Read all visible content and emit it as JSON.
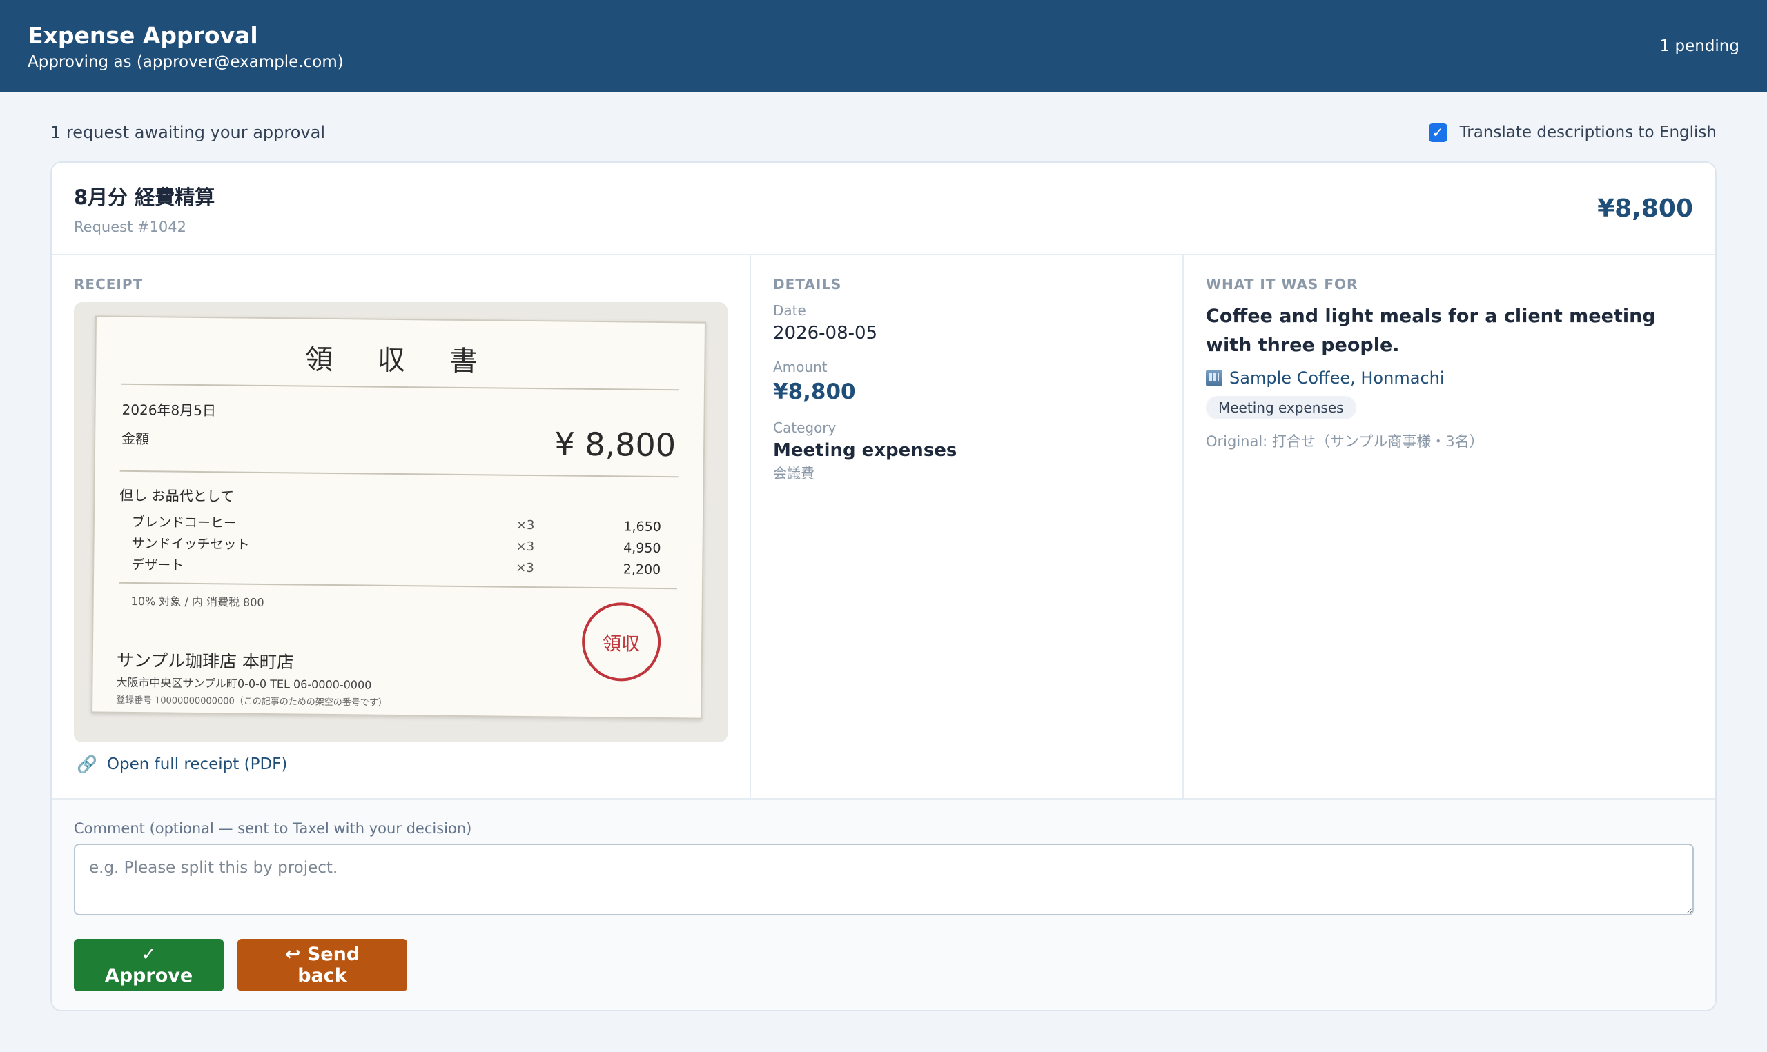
{
  "header": {
    "title": "Expense Approval",
    "subtitle": "Approving as (approver@example.com)",
    "pending": "1 pending"
  },
  "summary": {
    "text": "1 request awaiting your approval",
    "translate_label": "Translate descriptions to English",
    "translate_checked": true
  },
  "request": {
    "title": "8月分 経費精算",
    "number": "Request #1042",
    "amount": "¥8,800"
  },
  "receipt": {
    "section_label": "RECEIPT",
    "doc_title": "領 収 書",
    "date": "2026年8月5日",
    "amount_label": "金額",
    "amount": "¥ 8,800",
    "purpose": "但し お品代として",
    "items": [
      {
        "name": "ブレンドコーヒー",
        "qty": "×3",
        "price": "1,650"
      },
      {
        "name": "サンドイッチセット",
        "qty": "×3",
        "price": "4,950"
      },
      {
        "name": "デザート",
        "qty": "×3",
        "price": "2,200"
      }
    ],
    "tax_note": "10% 対象 / 内 消費税 800",
    "store": "サンプル珈琲店 本町店",
    "address": "大阪市中央区サンプル町0-0-0 TEL 06-0000-0000",
    "registration": "登録番号 T0000000000000（この記事のための架空の番号です）",
    "stamp": "領収",
    "pdf_link": "Open full receipt (PDF)"
  },
  "details": {
    "section_label": "DETAILS",
    "date_label": "Date",
    "date": "2026-08-05",
    "amount_label": "Amount",
    "amount": "¥8,800",
    "category_label": "Category",
    "category": "Meeting expenses",
    "category_original": "会議費"
  },
  "purpose": {
    "section_label": "WHAT IT WAS FOR",
    "description": "Coffee and light meals for a client meeting with three people.",
    "vendor": "Sample Coffee, Honmachi",
    "tag": "Meeting expenses",
    "original": "Original: 打合せ（サンプル商事様・3名）"
  },
  "comment": {
    "label": "Comment (optional — sent to Taxel with your decision)",
    "placeholder": "e.g. Please split this by project.",
    "value": ""
  },
  "actions": {
    "approve": "✓ Approve",
    "send_back": "↩ Send back"
  },
  "colors": {
    "header_bg": "#1f4e79",
    "approve": "#1e7e34",
    "send_back": "#b85510",
    "accent": "#1f4e79"
  }
}
